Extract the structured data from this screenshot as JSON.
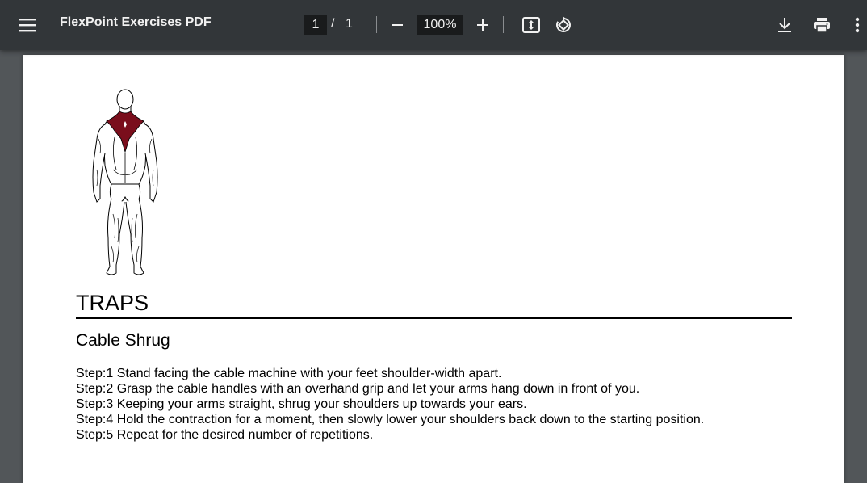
{
  "toolbar": {
    "title": "FlexPoint Exercises PDF",
    "page_current": "1",
    "page_separator": "/",
    "page_total": "1",
    "zoom": "100%",
    "icons": [
      "menu-icon",
      "zoom-out-icon",
      "zoom-in-icon",
      "fit-to-page-icon",
      "rotate-icon",
      "download-icon",
      "print-icon",
      "more-options-icon"
    ]
  },
  "document": {
    "muscle_group": "TRAPS",
    "exercise": "Cable Shrug",
    "steps": [
      "Step:1 Stand facing the cable machine with your feet shoulder-width apart.",
      "Step:2 Grasp the cable handles with an overhand grip and let your arms hang down in front of you.",
      "Step:3 Keeping your arms straight, shrug your shoulders up towards your ears.",
      "Step:4 Hold the contraction for a moment, then slowly lower your shoulders back down to the starting position.",
      "Step:5 Repeat for the desired number of repetitions."
    ],
    "highlight_color": "#7a0e1c"
  }
}
